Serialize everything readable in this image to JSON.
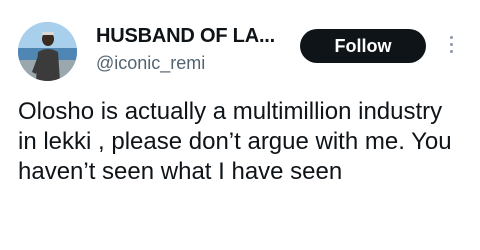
{
  "author": {
    "display_name": "HUSBAND OF LA...",
    "handle": "@iconic_remi",
    "avatar_icon": "profile-photo"
  },
  "actions": {
    "follow_label": "Follow",
    "more_icon": "vertical-ellipsis-icon"
  },
  "tweet": {
    "text": "Olosho is actually a multimillion industry in lekki , please don’t argue with me. You haven’t seen what I have seen"
  },
  "colors": {
    "text_primary": "#0f1419",
    "text_secondary": "#536471",
    "button_bg": "#0f1419",
    "button_text": "#ffffff"
  }
}
